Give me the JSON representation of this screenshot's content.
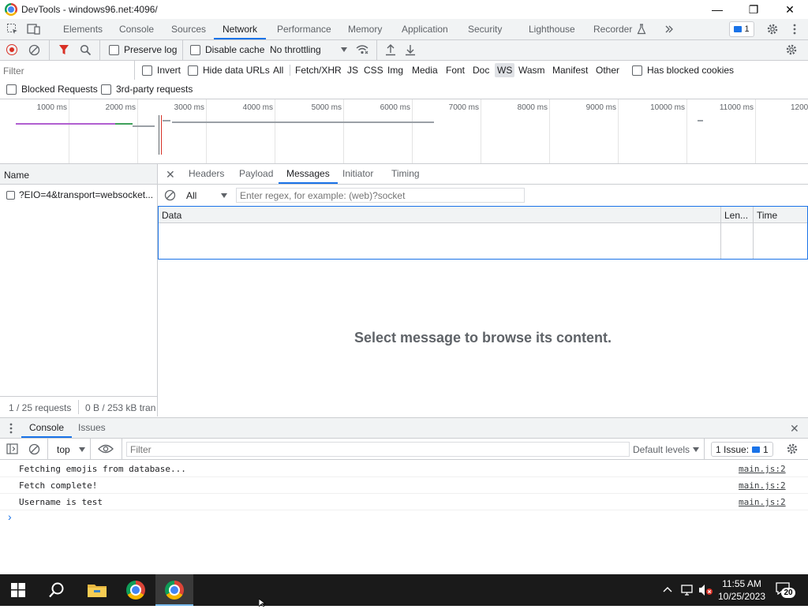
{
  "window": {
    "title": "DevTools - windows96.net:4096/",
    "minimize_glyph": "—",
    "restore_glyph": "❐",
    "close_glyph": "✕"
  },
  "panel_tabs": [
    {
      "label": "Elements"
    },
    {
      "label": "Console"
    },
    {
      "label": "Sources"
    },
    {
      "label": "Network"
    },
    {
      "label": "Performance"
    },
    {
      "label": "Memory"
    },
    {
      "label": "Application"
    },
    {
      "label": "Security"
    },
    {
      "label": "Lighthouse"
    },
    {
      "label": "Recorder"
    }
  ],
  "issues_badge": "1",
  "network_toolbar": {
    "preserve_log": "Preserve log",
    "disable_cache": "Disable cache",
    "throttling": "No throttling"
  },
  "filter_bar": {
    "placeholder": "Filter",
    "invert": "Invert",
    "hide_data_urls": "Hide data URLs",
    "types": [
      "All",
      "Fetch/XHR",
      "JS",
      "CSS",
      "Img",
      "Media",
      "Font",
      "Doc",
      "WS",
      "Wasm",
      "Manifest",
      "Other"
    ],
    "has_blocked_cookies": "Has blocked cookies",
    "blocked_requests": "Blocked Requests",
    "third_party": "3rd-party requests"
  },
  "overview": {
    "ticks": [
      "1000 ms",
      "2000 ms",
      "3000 ms",
      "4000 ms",
      "5000 ms",
      "6000 ms",
      "7000 ms",
      "8000 ms",
      "9000 ms",
      "10000 ms",
      "11000 ms",
      "1200"
    ]
  },
  "request_list": {
    "header": "Name",
    "rows": [
      {
        "name": "?EIO=4&transport=websocket..."
      }
    ],
    "status_requests": "1 / 25 requests",
    "status_transfer": "0 B / 253 kB tran"
  },
  "detail_tabs": [
    {
      "label": "Headers"
    },
    {
      "label": "Payload"
    },
    {
      "label": "Messages"
    },
    {
      "label": "Initiator"
    },
    {
      "label": "Timing"
    }
  ],
  "messages": {
    "filter_type": "All",
    "regex_placeholder": "Enter regex, for example: (web)?socket",
    "col_data": "Data",
    "col_length": "Len...",
    "col_time": "Time",
    "empty_text": "Select message to browse its content."
  },
  "drawer": {
    "tabs": [
      {
        "label": "Console"
      },
      {
        "label": "Issues"
      }
    ],
    "context": "top",
    "filter_placeholder": "Filter",
    "levels": "Default levels",
    "issues_label": "1 Issue:",
    "issues_count": "1",
    "logs": [
      {
        "text": "Fetching emojis from database...",
        "source": "main.js:2"
      },
      {
        "text": "Fetch complete!",
        "source": "main.js:2"
      },
      {
        "text": "Username is test",
        "source": "main.js:2"
      }
    ],
    "prompt": "›"
  },
  "taskbar": {
    "time": "11:55 AM",
    "date": "10/25/2023",
    "notification_count": "20"
  },
  "colors": {
    "accent": "#1a73e8",
    "record": "#d93025",
    "waterfall_purple": "#b05fd0",
    "waterfall_green": "#3fa05a",
    "waterfall_gray": "#9aa0a6"
  }
}
